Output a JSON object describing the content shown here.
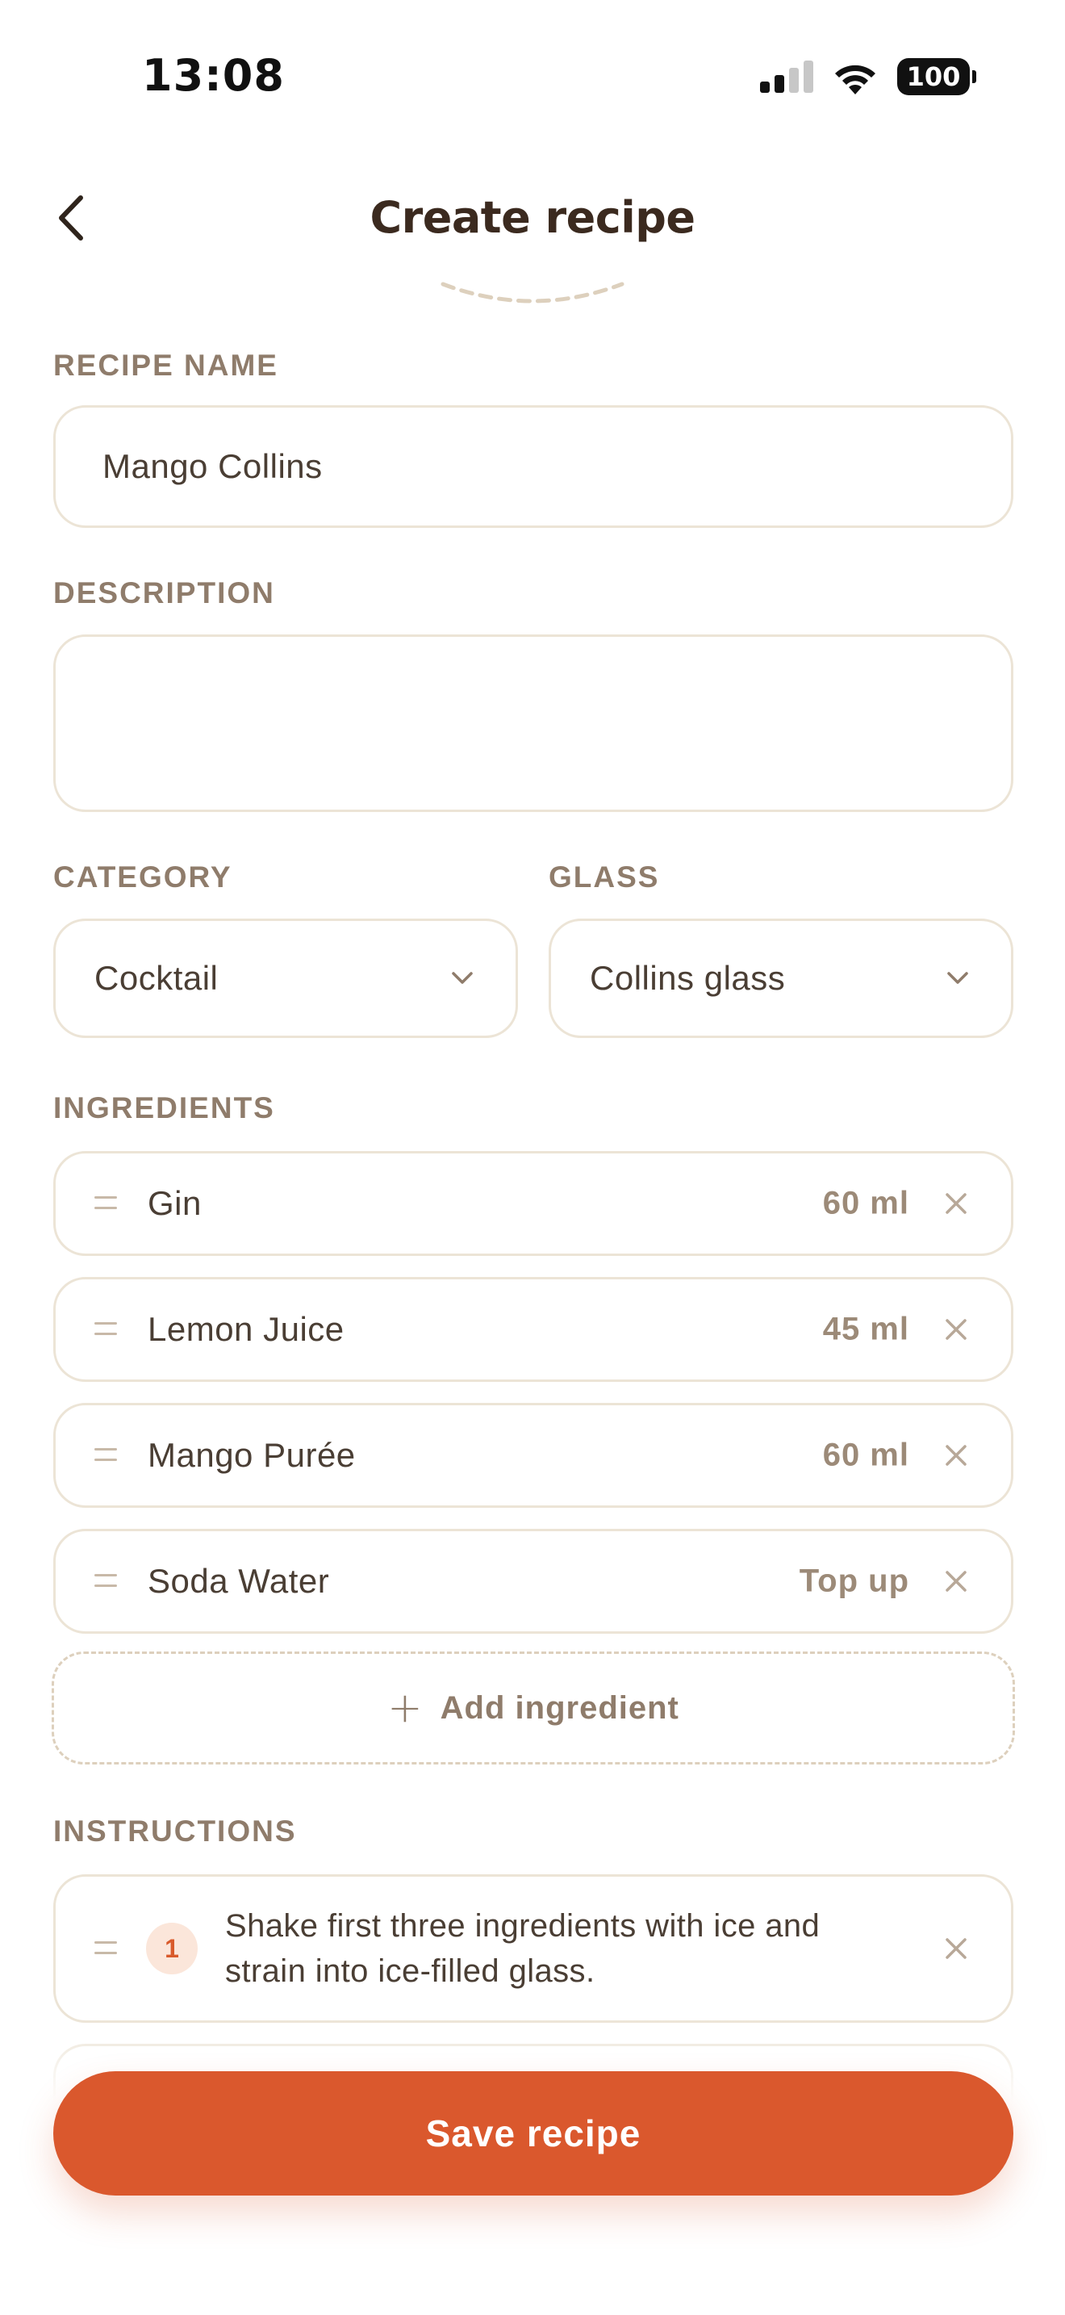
{
  "status_bar": {
    "time": "13:08",
    "battery": "100"
  },
  "header": {
    "title": "Create recipe",
    "back_icon": "chevron-left-icon"
  },
  "form": {
    "recipe_name": {
      "label": "RECIPE NAME",
      "value": "Mango Collins"
    },
    "description": {
      "label": "DESCRIPTION",
      "value": ""
    },
    "category": {
      "label": "CATEGORY",
      "value": "Cocktail"
    },
    "glass": {
      "label": "GLASS",
      "value": "Collins glass"
    }
  },
  "ingredients": {
    "label": "INGREDIENTS",
    "items": [
      {
        "name": "Gin",
        "amount": "60 ml"
      },
      {
        "name": "Lemon Juice",
        "amount": "45 ml"
      },
      {
        "name": "Mango Purée",
        "amount": "60 ml"
      },
      {
        "name": "Soda Water",
        "amount": "Top up"
      }
    ],
    "add_label": "Add ingredient"
  },
  "instructions": {
    "label": "INSTRUCTIONS",
    "steps": [
      {
        "number": "1",
        "text": "Shake first three ingredients with ice and strain into ice-filled glass."
      }
    ]
  },
  "save_label": "Save recipe",
  "colors": {
    "accent": "#da582d",
    "border": "#ece4d6",
    "label": "#8f7c6b"
  }
}
